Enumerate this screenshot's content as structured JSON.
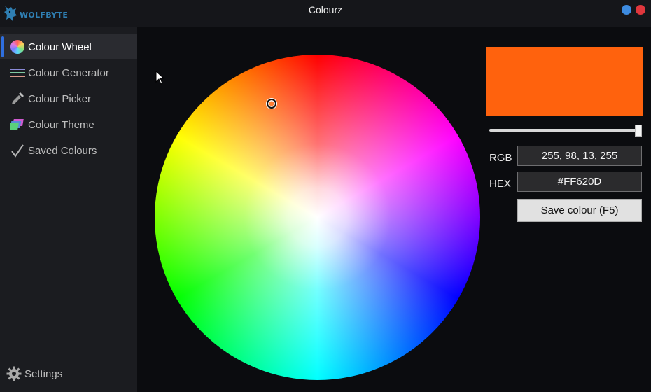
{
  "titlebar": {
    "brand_text": "WOLFBYTE",
    "title": "Colourz",
    "minimize_color": "#3d8be0",
    "close_color": "#e0373d"
  },
  "sidebar": {
    "items": [
      {
        "label": "Colour Wheel",
        "icon": "colour-wheel-icon",
        "active": true
      },
      {
        "label": "Colour Generator",
        "icon": "colour-generator-icon",
        "active": false
      },
      {
        "label": "Colour Picker",
        "icon": "eyedropper-icon",
        "active": false
      },
      {
        "label": "Colour Theme",
        "icon": "colour-theme-icon",
        "active": false
      },
      {
        "label": "Saved Colours",
        "icon": "checkmark-icon",
        "active": false
      }
    ],
    "settings_label": "Settings"
  },
  "colour": {
    "swatch": "#FF620D",
    "alpha_fraction": 1.0,
    "rgb_label": "RGB",
    "rgb_value": "255, 98, 13, 255",
    "hex_label": "HEX",
    "hex_value": "#FF620D",
    "save_label": "Save colour (F5)"
  },
  "accent": "#2f6fe0"
}
